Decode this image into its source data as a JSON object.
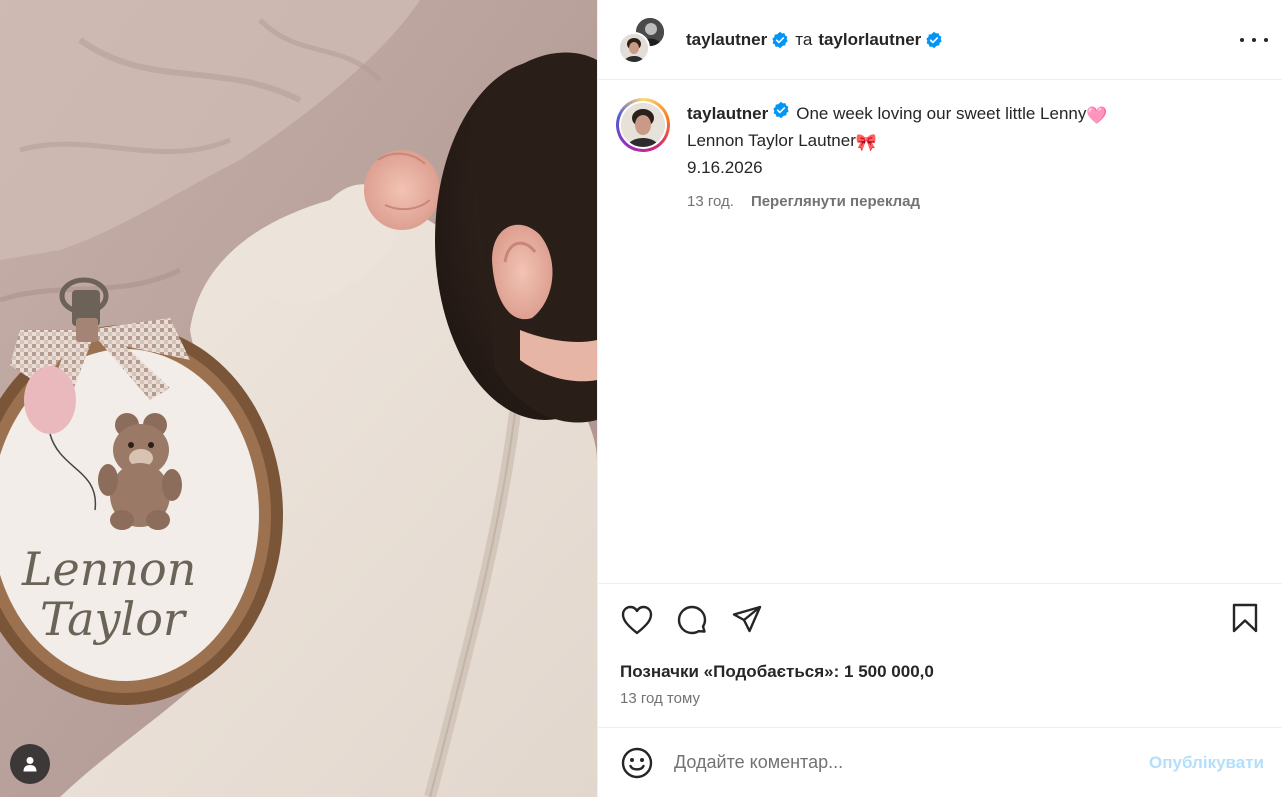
{
  "post": {
    "media": {
      "hoop_text_line1": "Lennon",
      "hoop_text_line2": "Taylor",
      "tag_button_icon": "user-icon"
    },
    "header": {
      "author1": "taylautner",
      "conjunction": "та",
      "author2": "taylorlautner",
      "verified_icon": "verified-badge-icon",
      "more_icon": "more-options-icon"
    },
    "caption": {
      "username": "taylautner",
      "line1": "One week loving our sweet little Lenny",
      "line1_emoji": "🩷",
      "line2": "Lennon Taylor Lautner",
      "line2_emoji": "🎀",
      "line3": "9.16.2026",
      "time": "13 год.",
      "translate": "Переглянути переклад"
    },
    "actions": {
      "like_icon": "heart-icon",
      "comment_icon": "comment-icon",
      "share_icon": "share-icon",
      "save_icon": "bookmark-icon",
      "likes_label": "Позначки «Подобається»:",
      "likes_count": "1 500 000,0",
      "time_ago": "13 год тому"
    },
    "composer": {
      "emoji_icon": "smiley-icon",
      "placeholder": "Додайте коментар...",
      "value": "",
      "submit_label": "Опублікувати"
    },
    "colors": {
      "verified_blue": "#0095f6",
      "post_disabled": "#b2dffc",
      "muted_text": "#737373",
      "text": "#262626"
    }
  }
}
